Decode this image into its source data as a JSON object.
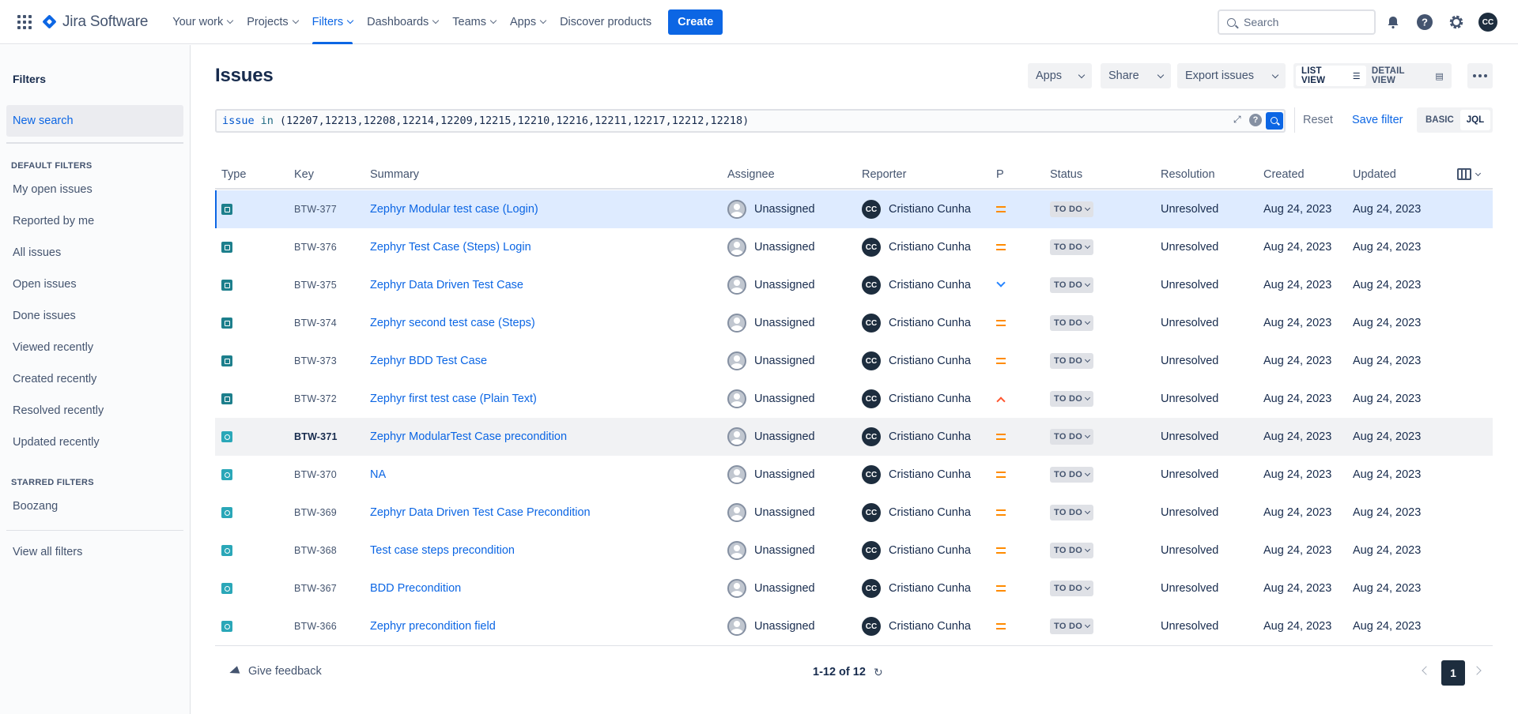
{
  "topnav": {
    "logo_text": "Jira Software",
    "items": [
      {
        "label": "Your work",
        "active": false
      },
      {
        "label": "Projects",
        "active": false
      },
      {
        "label": "Filters",
        "active": true
      },
      {
        "label": "Dashboards",
        "active": false
      },
      {
        "label": "Teams",
        "active": false
      },
      {
        "label": "Apps",
        "active": false
      }
    ],
    "discover_label": "Discover products",
    "create_label": "Create",
    "search_placeholder": "Search",
    "user_initials": "CC",
    "accent_color": "#0c66e4"
  },
  "sidebar": {
    "title": "Filters",
    "new_search": "New search",
    "default_heading": "DEFAULT FILTERS",
    "default_filters": [
      "My open issues",
      "Reported by me",
      "All issues",
      "Open issues",
      "Done issues",
      "Viewed recently",
      "Created recently",
      "Resolved recently",
      "Updated recently"
    ],
    "starred_heading": "STARRED FILTERS",
    "starred_filters": [
      "Boozang"
    ],
    "view_all": "View all filters"
  },
  "main": {
    "title": "Issues",
    "apps_label": "Apps",
    "share_label": "Share",
    "export_label": "Export issues",
    "list_view_label": "LIST VIEW",
    "detail_view_label": "DETAIL VIEW",
    "jql": {
      "field": "issue",
      "operator": "in",
      "value": "(12207,12213,12208,12214,12209,12215,12210,12216,12211,12217,12212,12218)"
    },
    "reset_label": "Reset",
    "save_filter_label": "Save filter",
    "basic_label": "BASIC",
    "jql_label": "JQL"
  },
  "table": {
    "columns": [
      "Type",
      "Key",
      "Summary",
      "Assignee",
      "Reporter",
      "P",
      "Status",
      "Resolution",
      "Created",
      "Updated"
    ],
    "rows": [
      {
        "type": "test-case",
        "key": "BTW-377",
        "summary": "Zephyr Modular test case (Login)",
        "assignee": "Unassigned",
        "reporter": "Cristiano Cunha",
        "reporter_initials": "CC",
        "priority": "medium",
        "status": "TO DO",
        "resolution": "Unresolved",
        "created": "Aug 24, 2023",
        "updated": "Aug 24, 2023",
        "state": "selected"
      },
      {
        "type": "test-case",
        "key": "BTW-376",
        "summary": "Zephyr Test Case (Steps) Login",
        "assignee": "Unassigned",
        "reporter": "Cristiano Cunha",
        "reporter_initials": "CC",
        "priority": "medium",
        "status": "TO DO",
        "resolution": "Unresolved",
        "created": "Aug 24, 2023",
        "updated": "Aug 24, 2023",
        "state": ""
      },
      {
        "type": "test-case",
        "key": "BTW-375",
        "summary": "Zephyr Data Driven Test Case",
        "assignee": "Unassigned",
        "reporter": "Cristiano Cunha",
        "reporter_initials": "CC",
        "priority": "low",
        "status": "TO DO",
        "resolution": "Unresolved",
        "created": "Aug 24, 2023",
        "updated": "Aug 24, 2023",
        "state": ""
      },
      {
        "type": "test-case",
        "key": "BTW-374",
        "summary": "Zephyr second test case (Steps)",
        "assignee": "Unassigned",
        "reporter": "Cristiano Cunha",
        "reporter_initials": "CC",
        "priority": "medium",
        "status": "TO DO",
        "resolution": "Unresolved",
        "created": "Aug 24, 2023",
        "updated": "Aug 24, 2023",
        "state": ""
      },
      {
        "type": "test-case",
        "key": "BTW-373",
        "summary": "Zephyr BDD Test Case",
        "assignee": "Unassigned",
        "reporter": "Cristiano Cunha",
        "reporter_initials": "CC",
        "priority": "medium",
        "status": "TO DO",
        "resolution": "Unresolved",
        "created": "Aug 24, 2023",
        "updated": "Aug 24, 2023",
        "state": ""
      },
      {
        "type": "test-case",
        "key": "BTW-372",
        "summary": "Zephyr first test case (Plain Text)",
        "assignee": "Unassigned",
        "reporter": "Cristiano Cunha",
        "reporter_initials": "CC",
        "priority": "high",
        "status": "TO DO",
        "resolution": "Unresolved",
        "created": "Aug 24, 2023",
        "updated": "Aug 24, 2023",
        "state": ""
      },
      {
        "type": "precondition",
        "key": "BTW-371",
        "summary": "Zephyr ModularTest Case precondition",
        "assignee": "Unassigned",
        "reporter": "Cristiano Cunha",
        "reporter_initials": "CC",
        "priority": "medium",
        "status": "TO DO",
        "resolution": "Unresolved",
        "created": "Aug 24, 2023",
        "updated": "Aug 24, 2023",
        "state": "hover"
      },
      {
        "type": "precondition",
        "key": "BTW-370",
        "summary": "NA",
        "assignee": "Unassigned",
        "reporter": "Cristiano Cunha",
        "reporter_initials": "CC",
        "priority": "medium",
        "status": "TO DO",
        "resolution": "Unresolved",
        "created": "Aug 24, 2023",
        "updated": "Aug 24, 2023",
        "state": ""
      },
      {
        "type": "precondition",
        "key": "BTW-369",
        "summary": "Zephyr Data Driven Test Case Precondition",
        "assignee": "Unassigned",
        "reporter": "Cristiano Cunha",
        "reporter_initials": "CC",
        "priority": "medium",
        "status": "TO DO",
        "resolution": "Unresolved",
        "created": "Aug 24, 2023",
        "updated": "Aug 24, 2023",
        "state": ""
      },
      {
        "type": "precondition",
        "key": "BTW-368",
        "summary": "Test case steps precondition",
        "assignee": "Unassigned",
        "reporter": "Cristiano Cunha",
        "reporter_initials": "CC",
        "priority": "medium",
        "status": "TO DO",
        "resolution": "Unresolved",
        "created": "Aug 24, 2023",
        "updated": "Aug 24, 2023",
        "state": ""
      },
      {
        "type": "precondition",
        "key": "BTW-367",
        "summary": "BDD Precondition",
        "assignee": "Unassigned",
        "reporter": "Cristiano Cunha",
        "reporter_initials": "CC",
        "priority": "medium",
        "status": "TO DO",
        "resolution": "Unresolved",
        "created": "Aug 24, 2023",
        "updated": "Aug 24, 2023",
        "state": ""
      },
      {
        "type": "precondition",
        "key": "BTW-366",
        "summary": "Zephyr precondition field",
        "assignee": "Unassigned",
        "reporter": "Cristiano Cunha",
        "reporter_initials": "CC",
        "priority": "medium",
        "status": "TO DO",
        "resolution": "Unresolved",
        "created": "Aug 24, 2023",
        "updated": "Aug 24, 2023",
        "state": ""
      }
    ]
  },
  "footer": {
    "feedback_label": "Give feedback",
    "count_text": "1-12 of 12",
    "current_page": "1"
  }
}
